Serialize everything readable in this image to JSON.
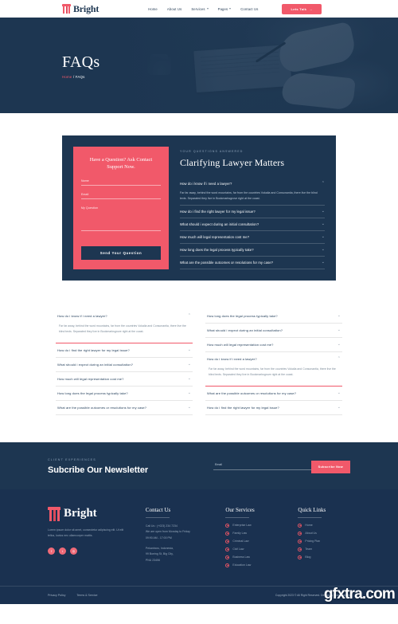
{
  "header": {
    "logo_text": "Bright",
    "nav": [
      {
        "label": "Home",
        "dropdown": false
      },
      {
        "label": "About Us",
        "dropdown": false
      },
      {
        "label": "Services",
        "dropdown": true
      },
      {
        "label": "Pages",
        "dropdown": true
      },
      {
        "label": "Contact Us",
        "dropdown": false
      }
    ],
    "cta_label": "Lets Talk",
    "cta_arrow": "→"
  },
  "hero": {
    "title": "FAQs",
    "breadcrumb_home": "Home",
    "breadcrumb_sep": "/",
    "breadcrumb_current": "FAQs"
  },
  "faq_card": {
    "form": {
      "title": "Have a Question? Ask Contact Support Now.",
      "fields": [
        {
          "label": "Name"
        },
        {
          "label": "Email"
        },
        {
          "label": "My Question"
        }
      ],
      "submit_label": "Send Your Question"
    },
    "eyebrow": "Your Questions Answered",
    "heading": "Clarifying Lawyer Matters",
    "items": [
      {
        "question": "How do i know if i need a lawyer?",
        "answer": "Far far away, behind the word mountains, far from the countries Vokalia and Consonantia, there live the blind texts. Separated they live in Bookmarksgrove right at the coast.",
        "open": true
      },
      {
        "question": "How do i find the right lawyer for my legal issue?",
        "open": false
      },
      {
        "question": "What should i expect during an initial consultation?",
        "open": false
      },
      {
        "question": "How much will legal representation cost me?",
        "open": false
      },
      {
        "question": "How long does the legal process typically take?",
        "open": false
      },
      {
        "question": "What are the possible outcomes or resolutions for my case?",
        "open": false
      }
    ],
    "chevron_open": "⌃",
    "chevron_closed": "⌄"
  },
  "columns": {
    "left": [
      {
        "question": "How do i know if i need a lawyer?",
        "answer": "Far far away, behind the word mountains, far from the countries Vokalia and Consonantia, there live the blind texts. Separated they live in Bookmarksgrove right at the coast.",
        "open": true
      },
      {
        "question": "How do i find the right lawyer for my legal issue?",
        "open": false
      },
      {
        "question": "What should i expect during an initial consultation?",
        "open": false
      },
      {
        "question": "How much will legal representation cost me?",
        "open": false
      },
      {
        "question": "How long does the legal process typically take?",
        "open": false
      },
      {
        "question": "What are the possible outcomes or resolutions for my case?",
        "open": false
      }
    ],
    "right": [
      {
        "question": "How long does the legal process typically take?",
        "open": false
      },
      {
        "question": "What should i expect during an initial consultation?",
        "open": false
      },
      {
        "question": "How much will legal representation cost me?",
        "open": false
      },
      {
        "question": "How do i know if i need a lawyer?",
        "answer": "Far far away, behind the word mountains, far from the countries Vokalia and Consonantia, there live the blind texts. Separated they live in Bookmarksgrove right at the coast.",
        "open": true
      },
      {
        "question": "What are the possible outcomes or resolutions for my case?",
        "open": false
      },
      {
        "question": "How do i find the right lawyer for my legal issue?",
        "open": false
      }
    ]
  },
  "newsletter": {
    "eyebrow": "Client Experiences",
    "title": "Subcribe Our Newsletter",
    "input_placeholder": "Email",
    "button_label": "Subscribe Now"
  },
  "footer": {
    "logo_text": "Bright",
    "description": "Lorem ipsum dolor sit amet, consectetur adipiscing elit. Ut elit tellus, luctus nec ullamcorper mattis.",
    "socials": [
      {
        "name": "facebook-icon",
        "glyph": "f"
      },
      {
        "name": "twitter-icon",
        "glyph": "t"
      },
      {
        "name": "instagram-icon",
        "glyph": "◎"
      }
    ],
    "contact": {
      "heading": "Contact Us",
      "lines": [
        "Call Us : (+023) 234 7234",
        "We are open from Monday to Friday",
        "09:90 AM - 17:00 PM"
      ],
      "address": [
        "Pekanbaru, Indonesia,",
        "99 Boeing St, Big City,",
        "PNU 23456"
      ]
    },
    "services": {
      "heading": "Our Services",
      "items": [
        "Enterprise Law",
        "Family Law",
        "Criminal Law",
        "Civil Law",
        "Business Law",
        "Education Law"
      ]
    },
    "quick_links": {
      "heading": "Quick Links",
      "items": [
        "Home",
        "About Us",
        "Pricing Plan",
        "Team",
        "Blog"
      ]
    },
    "bottom": {
      "privacy": "Privacy Policy",
      "terms": "Terms & Service",
      "copyright": "Copyright 2023 © All Right Reserved. Design by Biornathemes"
    }
  },
  "watermark": "gfxtra.com",
  "colors": {
    "navy": "#1d3651",
    "coral": "#f1596a",
    "muted": "#93a5b8"
  }
}
